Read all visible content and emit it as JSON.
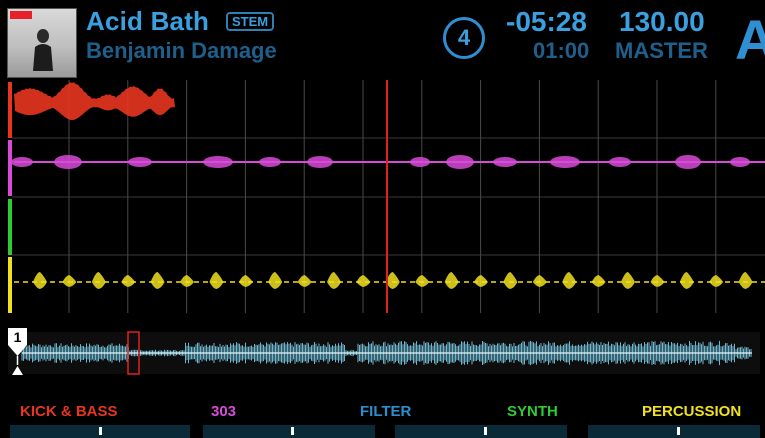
{
  "track": {
    "title": "Acid Bath",
    "stem_badge": "STEM",
    "artist": "Benjamin Damage"
  },
  "deck": {
    "number": "4",
    "letter": "A",
    "time_remaining": "-05:28",
    "time_elapsed": "01:00",
    "bpm": "130.00",
    "tempo_source": "MASTER"
  },
  "colors": {
    "accent": "#3aa0e0",
    "accent_dim": "#1f5f8c",
    "playhead": "#e02020",
    "stem_kick_bass": "#e8351f",
    "stem_303": "#d84ad8",
    "stem_filter": "#2a8fd0",
    "stem_synth": "#2ecc2e",
    "stem_percussion": "#f0e020",
    "overview_wave": "#7fd4f0"
  },
  "overview": {
    "cue_number": "1"
  },
  "stems": [
    {
      "label": "KICK & BASS",
      "color": "#e8351f"
    },
    {
      "label": "303",
      "color": "#d84ad8"
    },
    {
      "label": "FILTER",
      "color": "#2a8fd0"
    },
    {
      "label": "SYNTH",
      "color": "#2ecc2e"
    },
    {
      "label": "PERCUSSION",
      "color": "#f0e020"
    }
  ]
}
